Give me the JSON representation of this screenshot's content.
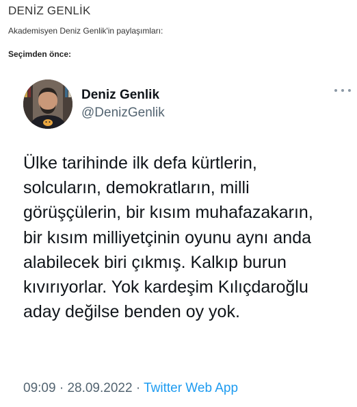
{
  "article": {
    "title": "DENİZ GENLİK",
    "subtitle": "Akademisyen Deniz Genlik'in paylaşımları:",
    "section_label": "Seçimden önce:"
  },
  "tweet": {
    "author_name": "Deniz Genlik",
    "author_handle": "@DenizGenlik",
    "text_lines": [
      "Ülke tarihinde ilk defa kürtlerin,",
      "solcuların, demokratların, milli",
      "görüşçülerin, bir kısım muhafazakarın,",
      "bir kısım milliyetçinin oyunu aynı anda",
      "alabilecek biri çıkmış. Kalkıp burun",
      "kıvırıyorlar. Yok kardeşim Kılıçdaroğlu",
      "aday değilse benden oy yok."
    ],
    "time": "09:09",
    "date": "28.09.2022",
    "separator": "·",
    "source": "Twitter Web App"
  },
  "icons": {
    "more": "more-horizontal-icon"
  },
  "colors": {
    "name": "#0f1419",
    "handle": "#536471",
    "link": "#1d9bf0"
  }
}
